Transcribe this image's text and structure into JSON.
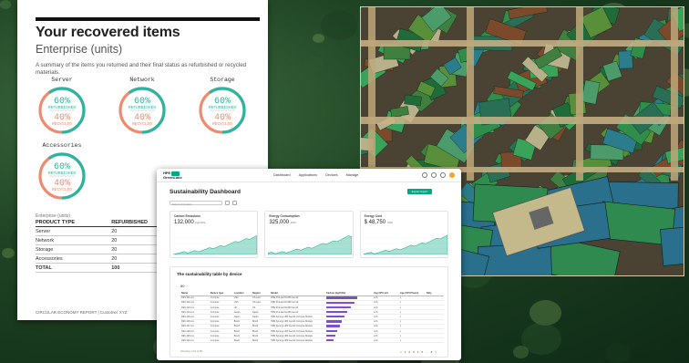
{
  "report": {
    "title": "Your recovered items",
    "subtitle": "Enterprise (units)",
    "description": "A summary of the items you returned and their final status as refurbished or recycled materials.",
    "gauges": [
      {
        "name": "Server",
        "refurbished_pct": 60,
        "recycled_pct": 40,
        "refurbished_text": "60%",
        "refurbished_label": "REFURBISHED",
        "recycled_text": "40%",
        "recycled_label": "RECYCLED"
      },
      {
        "name": "Network",
        "refurbished_pct": 60,
        "recycled_pct": 40,
        "refurbished_text": "60%",
        "refurbished_label": "REFURBISHED",
        "recycled_text": "40%",
        "recycled_label": "RECYCLED"
      },
      {
        "name": "Storage",
        "refurbished_pct": 60,
        "recycled_pct": 40,
        "refurbished_text": "60%",
        "refurbished_label": "REFURBISHED",
        "recycled_text": "40%",
        "recycled_label": "RECYCLED"
      },
      {
        "name": "Accessories",
        "refurbished_pct": 60,
        "recycled_pct": 40,
        "refurbished_text": "60%",
        "refurbished_label": "REFURBISHED",
        "recycled_text": "40%",
        "recycled_label": "RECYCLED"
      }
    ],
    "colors": {
      "refurbished": "#2bb5a0",
      "recycled": "#f08a6c"
    },
    "unit_note": "Enterprise (units)",
    "table": {
      "headers": [
        "PRODUCT TYPE",
        "REFURBISHED"
      ],
      "rows": [
        [
          "Server",
          "20"
        ],
        [
          "Network",
          "20"
        ],
        [
          "Storage",
          "20"
        ],
        [
          "Accessories",
          "20"
        ]
      ],
      "total": [
        "TOTAL",
        "100"
      ]
    },
    "footer": "CIRCULAR ECONOMY REPORT | Customer XYZ"
  },
  "dashboard": {
    "brand_line1": "HPE",
    "brand_line2": "GreenLake",
    "menu": [
      "Dashboard",
      "Applications",
      "Devices",
      "Manage"
    ],
    "title": "Sustainability Dashboard",
    "export_label": "Export report",
    "filter_value": "Select all location",
    "cards": [
      {
        "label": "Carbon Emissions",
        "value": "132,000",
        "unit": "kgCO2e"
      },
      {
        "label": "Energy Consumption",
        "value": "325,000",
        "unit": "kWh"
      },
      {
        "label": "Energy Cost",
        "value": "$ 48,750",
        "unit": "USD"
      }
    ],
    "accent": "#01a982",
    "table_title": "The sustainability table by device",
    "table_count": "80",
    "table": {
      "headers": [
        "Name",
        "Device type",
        "Location",
        "Region",
        "Model",
        "Carbon (kgCO2e)",
        "Avg CPU util",
        "Age (CPU/Years)",
        "Tally"
      ],
      "rows": [
        {
          "name": "DEV-101-xxx",
          "type": "Compute",
          "loc": "USA",
          "region": "US-east",
          "model": "HPE ProLiant DL380 Gen10",
          "carbon_pct": 90,
          "cpu": "xx%",
          "age": "x"
        },
        {
          "name": "DEV-102-xxx",
          "type": "Compute",
          "loc": "USA",
          "region": "US-west",
          "model": "HPE ProLiant DL380 Gen10",
          "carbon_pct": 82,
          "cpu": "xx%",
          "age": "x"
        },
        {
          "name": "DEV-103-xxx",
          "type": "Compute",
          "loc": "UK",
          "region": "UK",
          "model": "HPE ProLiant DL380 Gen10",
          "carbon_pct": 70,
          "cpu": "xx%",
          "age": "x"
        },
        {
          "name": "DEV-104-xxx",
          "type": "Compute",
          "loc": "Japan",
          "region": "Japan",
          "model": "HPE ProLiant DL380 Gen10",
          "carbon_pct": 60,
          "cpu": "xx%",
          "age": "x"
        },
        {
          "name": "DEV-105-xxx",
          "type": "Compute",
          "loc": "Japan",
          "region": "Japan",
          "model": "HPE Synergy 480 Gen10 Compute Module",
          "carbon_pct": 52,
          "cpu": "xx%",
          "age": "x"
        },
        {
          "name": "DEV-106-xxx",
          "type": "Compute",
          "loc": "Brazil",
          "region": "Brazil",
          "model": "HPE Synergy 480 Gen10 Compute Module",
          "carbon_pct": 46,
          "cpu": "xx%",
          "age": "x"
        },
        {
          "name": "DEV-107-xxx",
          "type": "Compute",
          "loc": "Brazil",
          "region": "Brazil",
          "model": "HPE Synergy 480 Gen10 Compute Module",
          "carbon_pct": 40,
          "cpu": "xx%",
          "age": "x"
        },
        {
          "name": "DEV-108-xxx",
          "type": "Compute",
          "loc": "Brazil",
          "region": "Brazil",
          "model": "HPE Synergy 480 Gen10 Compute Module",
          "carbon_pct": 33,
          "cpu": "xx%",
          "age": "x"
        },
        {
          "name": "DEV-109-xxx",
          "type": "Compute",
          "loc": "Brazil",
          "region": "Brazil",
          "model": "HPE Synergy 480 Gen10 Compute Module",
          "carbon_pct": 27,
          "cpu": "xx%",
          "age": "x"
        },
        {
          "name": "DEV-110-xxx",
          "type": "Compute",
          "loc": "Brazil",
          "region": "Brazil",
          "model": "HPE Synergy 480 Gen10 Compute Module",
          "carbon_pct": 20,
          "cpu": "xx%",
          "age": "x"
        }
      ]
    },
    "table_footer": "Showing 1-10 of 80",
    "pager": [
      "<",
      "1",
      "2",
      "3",
      "4",
      "5",
      "...",
      "8",
      ">"
    ]
  }
}
